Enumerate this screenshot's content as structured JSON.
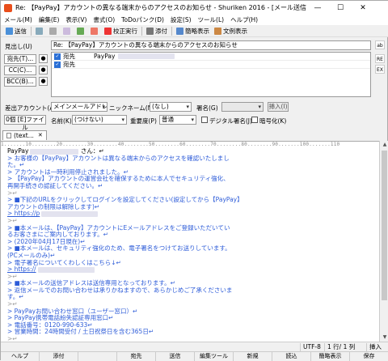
{
  "window": {
    "title": "Re: 【PayPay】アカウントの異なる端末からのアクセスのお知らせ",
    "title_suffix": " - Shuriken 2016 - [メール送信]",
    "minimize": "—",
    "maximize": "☐",
    "close": "✕"
  },
  "menu": [
    "メール(M)",
    "編集(E)",
    "表示(V)",
    "書式(O)",
    "ToDoパンク(D)",
    "設定(S)",
    "ツール(L)",
    "ヘルプ(H)"
  ],
  "toolbar": {
    "send": "送信",
    "proofread": "校正実行",
    "attach": "添付",
    "simple_view": "簡略表示",
    "text_view": "文例表示"
  },
  "header": {
    "subject_label": "見出し(U)",
    "subject": "Re: 【PayPay】アカウントの異なる端末からのアクセスのお知らせ",
    "to_button": "宛先(T)...",
    "cc_button": "CC(C)...",
    "bcc_button": "BCC(B)...",
    "recipients": [
      {
        "type": "宛先",
        "name": "PayPay"
      },
      {
        "type": "宛先",
        "name": ""
      }
    ],
    "from_label": "差出アカウント(A)",
    "from_value": "メインメールアドレス",
    "nickname_label": "ニックネーム(N)",
    "nickname_value": "(なし)",
    "signature_label": "署名(G)",
    "signature_value": "",
    "insert_button": "挿入(I)",
    "attach_count": "0個",
    "attach_label": "[E]ファイル",
    "name_label": "名前(K)",
    "name_value": "(つけない)",
    "priority_label": "重要度(P)",
    "priority_value": "普通",
    "digital_sign": "デジタル署名(J)",
    "encrypt": "暗号化(K)"
  },
  "tab": {
    "label": "(text...",
    "close": "✕"
  },
  "ruler": "1.......10........20........30........40........50........60........70........80........90.......100.......110",
  "body_lines": [
    {
      "kind": "plain",
      "text": "PayPay",
      "tail": " さん：↵"
    },
    {
      "kind": "q",
      "text": "> お客様の【PayPay】アカウントは異なる端末からのアクセスを確認いたしまし"
    },
    {
      "kind": "q",
      "text": "た。↵"
    },
    {
      "kind": "q",
      "text": "> アカウントは一時利用停止されました。↵"
    },
    {
      "kind": "q",
      "text": "> 【PayPay】アカウントの運営会社を確保するために本人でセキュリティ強化、"
    },
    {
      "kind": "q",
      "text": "再開手続きの認証してください。↵"
    },
    {
      "kind": "mark",
      "text": ">↵"
    },
    {
      "kind": "q",
      "text": "> ■下記のURLをクリックしてログインを設定してください(設定してから【PayPay】"
    },
    {
      "kind": "q",
      "text": "アカウントの制限は解除します)↵"
    },
    {
      "kind": "link",
      "text": "> https://p"
    },
    {
      "kind": "mark",
      "text": ">↵"
    },
    {
      "kind": "q",
      "text": "> ■本メールは、【PayPay】アカウントにEメールアドレスをご登録いただいてい"
    },
    {
      "kind": "q",
      "text": "るお客さまにご案内しております。↵"
    },
    {
      "kind": "q",
      "text": "> (2020年04月17日現在)↵"
    },
    {
      "kind": "q",
      "text": "> ■本メールは、セキュリティ強化のため、電子署名をつけてお送りしています。"
    },
    {
      "kind": "q",
      "text": "(PCメールのみ)↵"
    },
    {
      "kind": "q",
      "text": "> 電子署名についてくわしくはこちら↓↵"
    },
    {
      "kind": "link",
      "text": "> https://"
    },
    {
      "kind": "mark",
      "text": ">↵"
    },
    {
      "kind": "q",
      "text": "> ■本メールの送信アドレスは送信専用となっております。↵"
    },
    {
      "kind": "q",
      "text": "> 返信メールでのお問い合わせは承りかねますので、あらかじめご了承くださいま"
    },
    {
      "kind": "q",
      "text": "す。↵"
    },
    {
      "kind": "mark",
      "text": ">↵"
    },
    {
      "kind": "q",
      "text": "> PayPayお問い合わせ窓口（ユーザー窓口）↵"
    },
    {
      "kind": "q",
      "text": "> PayPay携帯電話紛失認証専用窓口↵"
    },
    {
      "kind": "q",
      "text": "> 電話番号：0120-990-633↵"
    },
    {
      "kind": "q",
      "text": "> 営業時間：24時間受付 / 土日祝祭日を含む365日↵"
    },
    {
      "kind": "mark",
      "text": ">↵"
    },
    {
      "kind": "q",
      "text": "> ■PayPay株式会社↵"
    },
    {
      "kind": "link",
      "text": "> ■https://paypay.ne.jp",
      "tail": "[EOF]"
    }
  ],
  "status": {
    "encoding": "UTF-8",
    "position": "1 行/  1 列",
    "mode": "挿入"
  },
  "fkeys": [
    "ヘルプ",
    "添付",
    "",
    "宛先",
    "送信",
    "編集ツール",
    "新規",
    "読込",
    "簡略表示",
    "保存"
  ]
}
